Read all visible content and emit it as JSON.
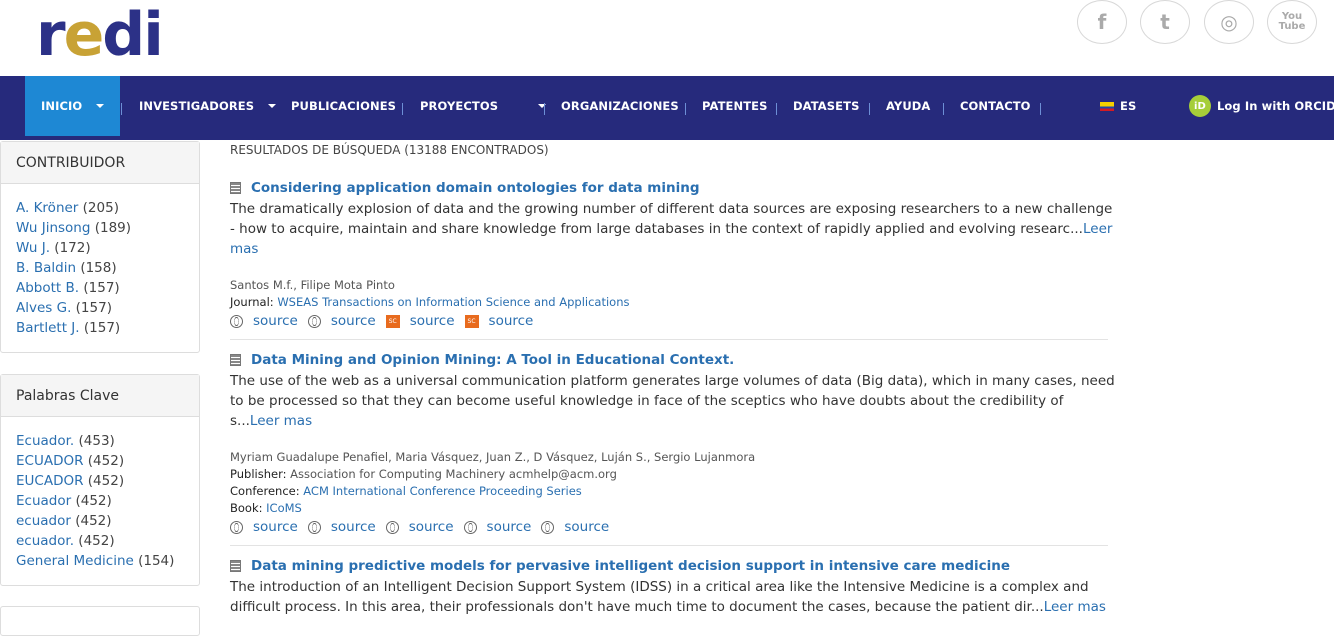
{
  "brand": {
    "logo_text_a": "r",
    "logo_text_b": "e",
    "logo_text_c": "di"
  },
  "social": {
    "facebook": "f",
    "twitter": "t",
    "instagram": "◎",
    "youtube": "You Tube"
  },
  "nav": {
    "items": [
      {
        "label": "INICIO"
      },
      {
        "label": "INVESTIGADORES"
      },
      {
        "label": "PUBLICACIONES"
      },
      {
        "label": "PROYECTOS"
      },
      {
        "label": "ORGANIZACIONES"
      },
      {
        "label": "PATENTES"
      },
      {
        "label": "DATASETS"
      },
      {
        "label": "AYUDA"
      },
      {
        "label": "CONTACTO"
      }
    ],
    "language": "ES",
    "orcid_badge": "iD",
    "orcid_login": "Log In with ORCID"
  },
  "sidebar": {
    "contributors": {
      "title": "CONTRIBUIDOR",
      "items": [
        {
          "name": "A. Kröner",
          "count": "(205)"
        },
        {
          "name": "Wu Jinsong",
          "count": "(189)"
        },
        {
          "name": "Wu J.",
          "count": "(172)"
        },
        {
          "name": "B. Baldin",
          "count": "(158)"
        },
        {
          "name": "Abbott B.",
          "count": "(157)"
        },
        {
          "name": "Alves G.",
          "count": "(157)"
        },
        {
          "name": "Bartlett J.",
          "count": "(157)"
        }
      ]
    },
    "keywords": {
      "title": "Palabras Clave",
      "items": [
        {
          "name": "Ecuador.",
          "count": "(453)"
        },
        {
          "name": "ECUADOR",
          "count": "(452)"
        },
        {
          "name": "EUCADOR",
          "count": "(452)"
        },
        {
          "name": "Ecuador",
          "count": "(452)"
        },
        {
          "name": "ecuador",
          "count": "(452)"
        },
        {
          "name": "ecuador.",
          "count": "(452)"
        },
        {
          "name": "General Medicine",
          "count": "(154)"
        }
      ]
    }
  },
  "results": {
    "count_text": "RESULTADOS DE BÚSQUEDA (13188 ENCONTRADOS)",
    "read_more": "Leer mas",
    "source_label": "source",
    "items": [
      {
        "title": "Considering application domain ontologies for data mining",
        "abstract": "The dramatically explosion of data and the growing number of different data sources are exposing researchers to a new challenge - how to acquire, maintain and share knowledge from large databases in the context of rapidly applied and evolving researc...",
        "authors": "Santos M.f.,   Filipe Mota Pinto",
        "journal_label": "Journal:",
        "journal": "WSEAS Transactions on Information Science and Applications"
      },
      {
        "title": "Data Mining and Opinion Mining: A Tool in Educational Context.",
        "abstract": "The use of the web as a universal communication platform generates large volumes of data (Big data), which in many cases, need to be processed so that they can become useful knowledge in face of the sceptics who have doubts about the credibility of s...",
        "authors": "Myriam Guadalupe Penafiel,   Maria Vásquez,   Juan Z.,   D Vásquez,   Luján S.,   Sergio Lujanmora",
        "publisher_label": "Publisher:",
        "publisher": "Association for Computing Machinery acmhelp@acm.org",
        "conference_label": "Conference:",
        "conference": "ACM International Conference Proceeding Series",
        "book_label": "Book:",
        "book": "ICoMS"
      },
      {
        "title": "Data mining predictive models for pervasive intelligent decision support in intensive care medicine",
        "abstract": "The introduction of an Intelligent Decision Support System (IDSS) in a critical area like the Intensive Medicine is a complex and difficult process. In this area, their professionals don't have much time to document the cases, because the patient dir..."
      }
    ]
  },
  "colors": {
    "nav_bg": "#262a7c",
    "nav_active": "#1e88d4",
    "link": "#2a6fb0",
    "logo": "#2c3187"
  }
}
